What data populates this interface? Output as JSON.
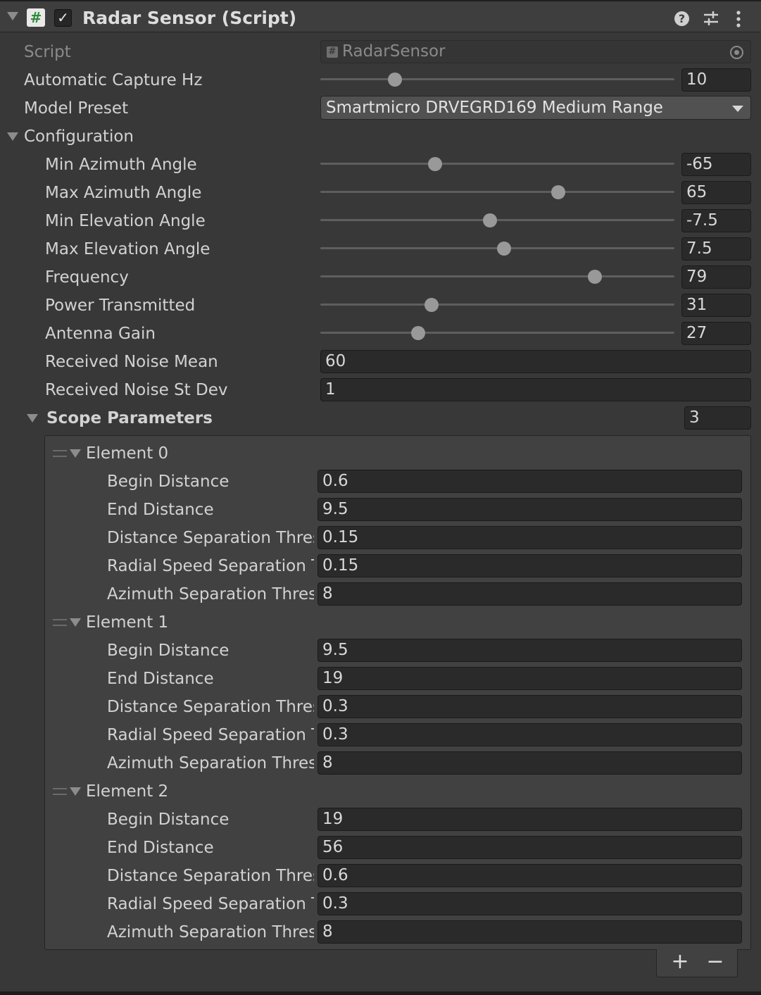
{
  "component": {
    "title": "Radar Sensor (Script)",
    "script_label": "Script",
    "script_value": "RadarSensor",
    "icons": [
      "script-icon",
      "help-icon",
      "presets-icon",
      "more-icon",
      "object-picker-icon"
    ]
  },
  "fields": {
    "capture_hz": {
      "label": "Automatic Capture Hz",
      "value": "10",
      "slider": 0.21
    },
    "model_preset": {
      "label": "Model Preset",
      "value": "Smartmicro DRVEGRD169 Medium Range"
    }
  },
  "configuration": {
    "label": "Configuration",
    "min_azimuth": {
      "label": "Min Azimuth Angle",
      "value": "-65",
      "slider": 0.325
    },
    "max_azimuth": {
      "label": "Max Azimuth Angle",
      "value": "65",
      "slider": 0.672
    },
    "min_elevation": {
      "label": "Min Elevation Angle",
      "value": "-7.5",
      "slider": 0.479
    },
    "max_elevation": {
      "label": "Max Elevation Angle",
      "value": "7.5",
      "slider": 0.519
    },
    "frequency": {
      "label": "Frequency",
      "value": "79",
      "slider": 0.776
    },
    "power_transmitted": {
      "label": "Power Transmitted",
      "value": "31",
      "slider": 0.314
    },
    "antenna_gain": {
      "label": "Antenna Gain",
      "value": "27",
      "slider": 0.277
    },
    "noise_mean": {
      "label": "Received Noise Mean",
      "value": "60"
    },
    "noise_stdev": {
      "label": "Received Noise St Dev",
      "value": "1"
    }
  },
  "scope": {
    "label": "Scope Parameters",
    "count": "3",
    "labels": {
      "begin": "Begin Distance",
      "end": "End Distance",
      "dist_sep": "Distance Separation Thres",
      "radial_sep": "Radial Speed Separation T",
      "azimuth_sep": "Azimuth Separation Thresh"
    },
    "elements": [
      {
        "title": "Element 0",
        "begin": "0.6",
        "end": "9.5",
        "dist_sep": "0.15",
        "radial_sep": "0.15",
        "azimuth_sep": "8"
      },
      {
        "title": "Element 1",
        "begin": "9.5",
        "end": "19",
        "dist_sep": "0.3",
        "radial_sep": "0.3",
        "azimuth_sep": "8"
      },
      {
        "title": "Element 2",
        "begin": "19",
        "end": "56",
        "dist_sep": "0.6",
        "radial_sep": "0.3",
        "azimuth_sep": "8"
      }
    ],
    "add_label": "+",
    "remove_label": "−"
  }
}
